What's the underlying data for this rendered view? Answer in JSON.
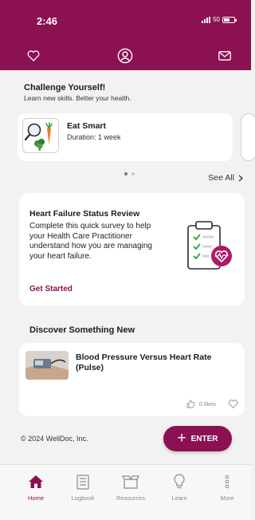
{
  "status_bar": {
    "time": "2:46",
    "battery": "50"
  },
  "header": {},
  "challenge": {
    "title": "Challenge Yourself!",
    "subtitle": "Learn new skills. Better your health.",
    "card": {
      "title": "Eat Smart",
      "duration": "Duration: 1 week"
    },
    "see_all_label": "See All",
    "page_count": 2,
    "active_page": 1
  },
  "survey": {
    "title": "Heart Failure Status Review",
    "body": "Complete this quick survey to help your Health Care Practitioner understand how you are managing your heart failure.",
    "cta": "Get Started"
  },
  "discover": {
    "title": "Discover Something New",
    "article": {
      "title": "Blood Pressure Versus Heart Rate (Pulse)",
      "likes": "0 likes"
    }
  },
  "footer": {
    "copyright": "© 2024 WellDoc, Inc.",
    "enter_label": "ENTER"
  },
  "tabs": [
    {
      "label": "Home",
      "icon": "home-icon",
      "active": true
    },
    {
      "label": "Logbook",
      "icon": "logbook-icon",
      "active": false
    },
    {
      "label": "Resources",
      "icon": "resources-icon",
      "active": false
    },
    {
      "label": "Learn",
      "icon": "learn-icon",
      "active": false
    },
    {
      "label": "More",
      "icon": "more-icon",
      "active": false
    }
  ],
  "colors": {
    "brand": "#8b1152",
    "background": "#f2f2f2",
    "inactive_tab": "#8a8a8a"
  }
}
